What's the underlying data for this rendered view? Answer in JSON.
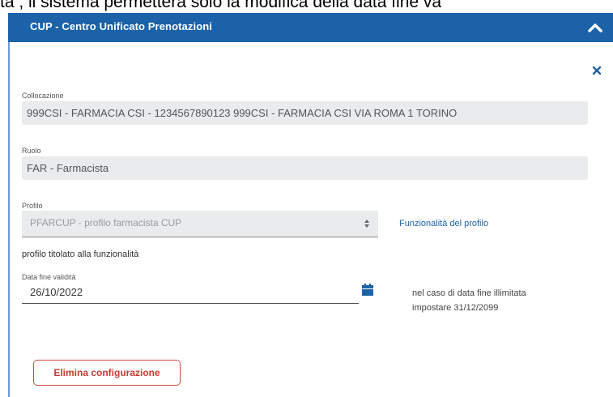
{
  "doc_text_top": "ta , il sistema permetterà solo la modifica della data fine va",
  "header": {
    "title": "CUP - Centro Unificato Prenotazioni"
  },
  "collocazione": {
    "label": "Collocazione",
    "value": "999CSI - FARMACIA CSI - 1234567890123 999CSI - FARMACIA CSI VIA ROMA 1 TORINO"
  },
  "ruolo": {
    "label": "Ruolo",
    "value": "FAR - Farmacista"
  },
  "profilo": {
    "label": "Profilo",
    "value": "PFARCUP - profilo farmacista CUP",
    "link": "Funzionalità del profilo",
    "note": "profilo titolato alla funzionalità"
  },
  "data_fine": {
    "label": "Data fine validità",
    "value": "26/10/2022",
    "note_line1": "nel caso di data fine illimitata",
    "note_line2": "impostare 31/12/2099"
  },
  "actions": {
    "delete_label": "Elimina configurazione"
  },
  "colors": {
    "header_bg": "#1b62a8",
    "danger": "#c53b30",
    "link": "#1b62a8"
  }
}
